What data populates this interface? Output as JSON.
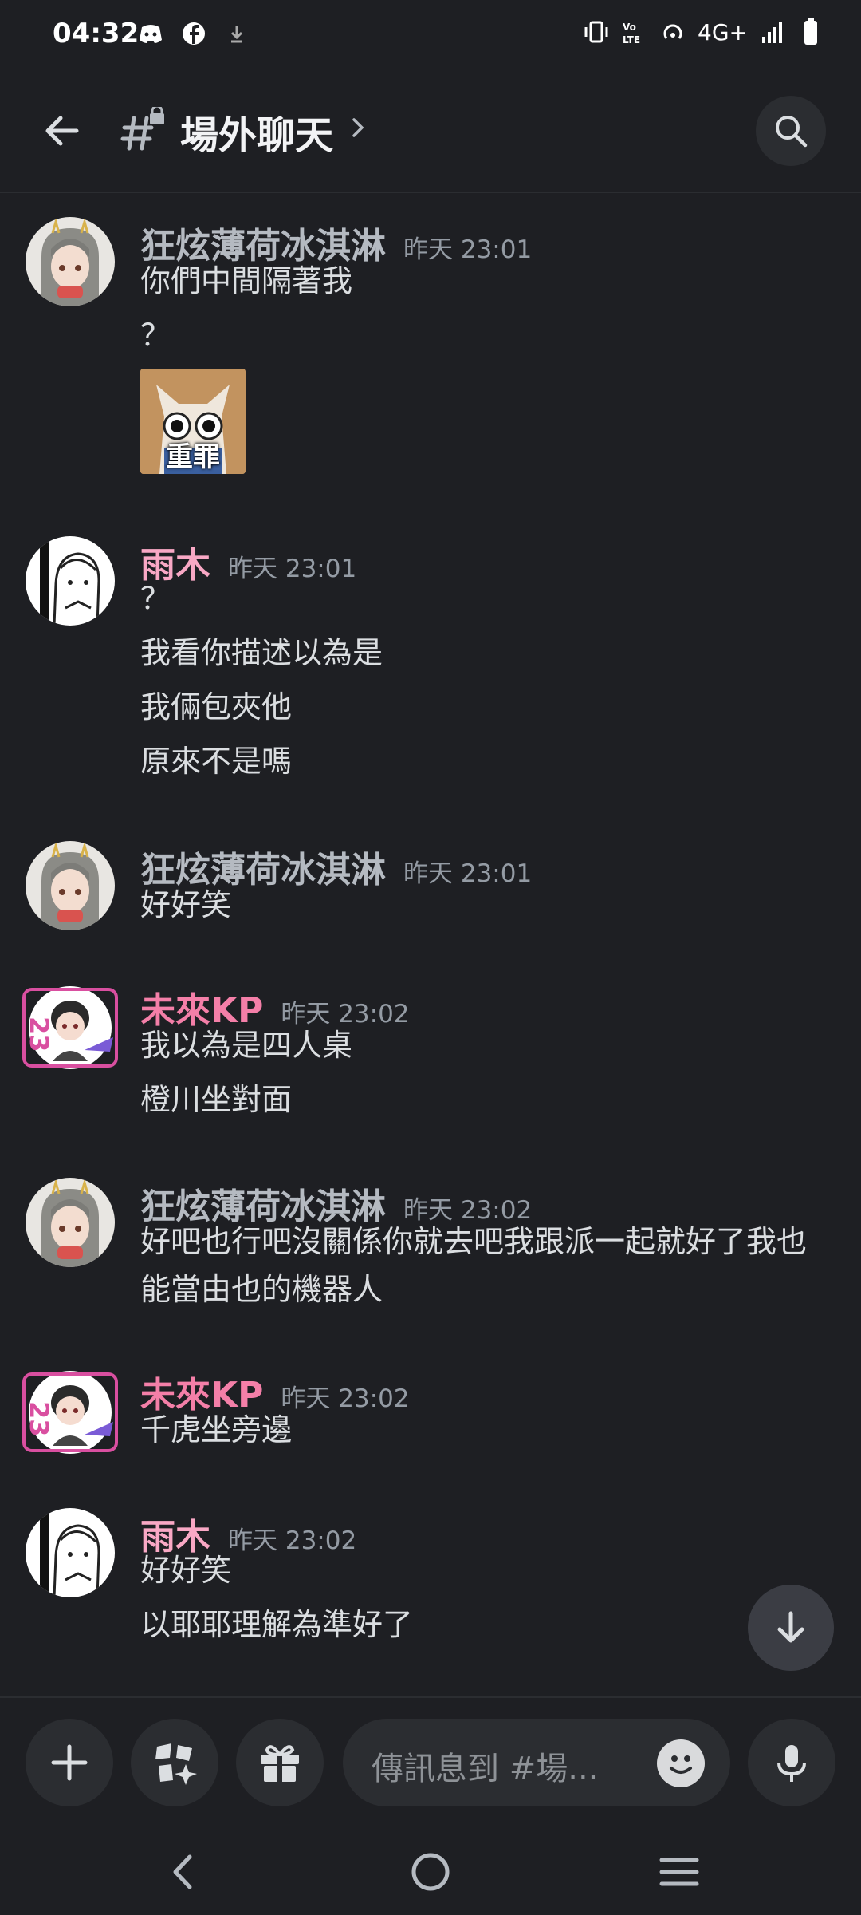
{
  "status_bar": {
    "time": "04:32",
    "network": "4G+"
  },
  "header": {
    "channel_name": "場外聊天"
  },
  "messages": [
    {
      "author": "狂炫薄荷冰淇淋",
      "time": "昨天 23:01",
      "lines": [
        "你們中間隔著我",
        "？"
      ],
      "sticker_text": "重罪"
    },
    {
      "author": "雨木",
      "time": "昨天 23:01",
      "lines": [
        "？",
        "我看你描述以為是",
        "我倆包夾他",
        "原來不是嗎"
      ]
    },
    {
      "author": "狂炫薄荷冰淇淋",
      "time": "昨天 23:01",
      "lines": [
        "好好笑"
      ]
    },
    {
      "author": "未來KP",
      "time": "昨天 23:02",
      "lines": [
        "我以為是四人桌",
        "橙川坐對面"
      ]
    },
    {
      "author": "狂炫薄荷冰淇淋",
      "time": "昨天 23:02",
      "lines": [
        "好吧也行吧沒關係你就去吧我跟派一起就好了我也",
        "能當由也的機器人"
      ]
    },
    {
      "author": "未來KP",
      "time": "昨天 23:02",
      "lines": [
        "千虎坐旁邊"
      ]
    },
    {
      "author": "雨木",
      "time": "昨天 23:02",
      "lines": [
        "好好笑",
        "以耶耶理解為準好了"
      ]
    }
  ],
  "composer": {
    "placeholder": "傳訊息到 #場..."
  },
  "colors": {
    "background": "#1e1f23",
    "surface": "#2b2d31",
    "pink_author": "#f9a8c5",
    "kp_author": "#f47fa8"
  }
}
